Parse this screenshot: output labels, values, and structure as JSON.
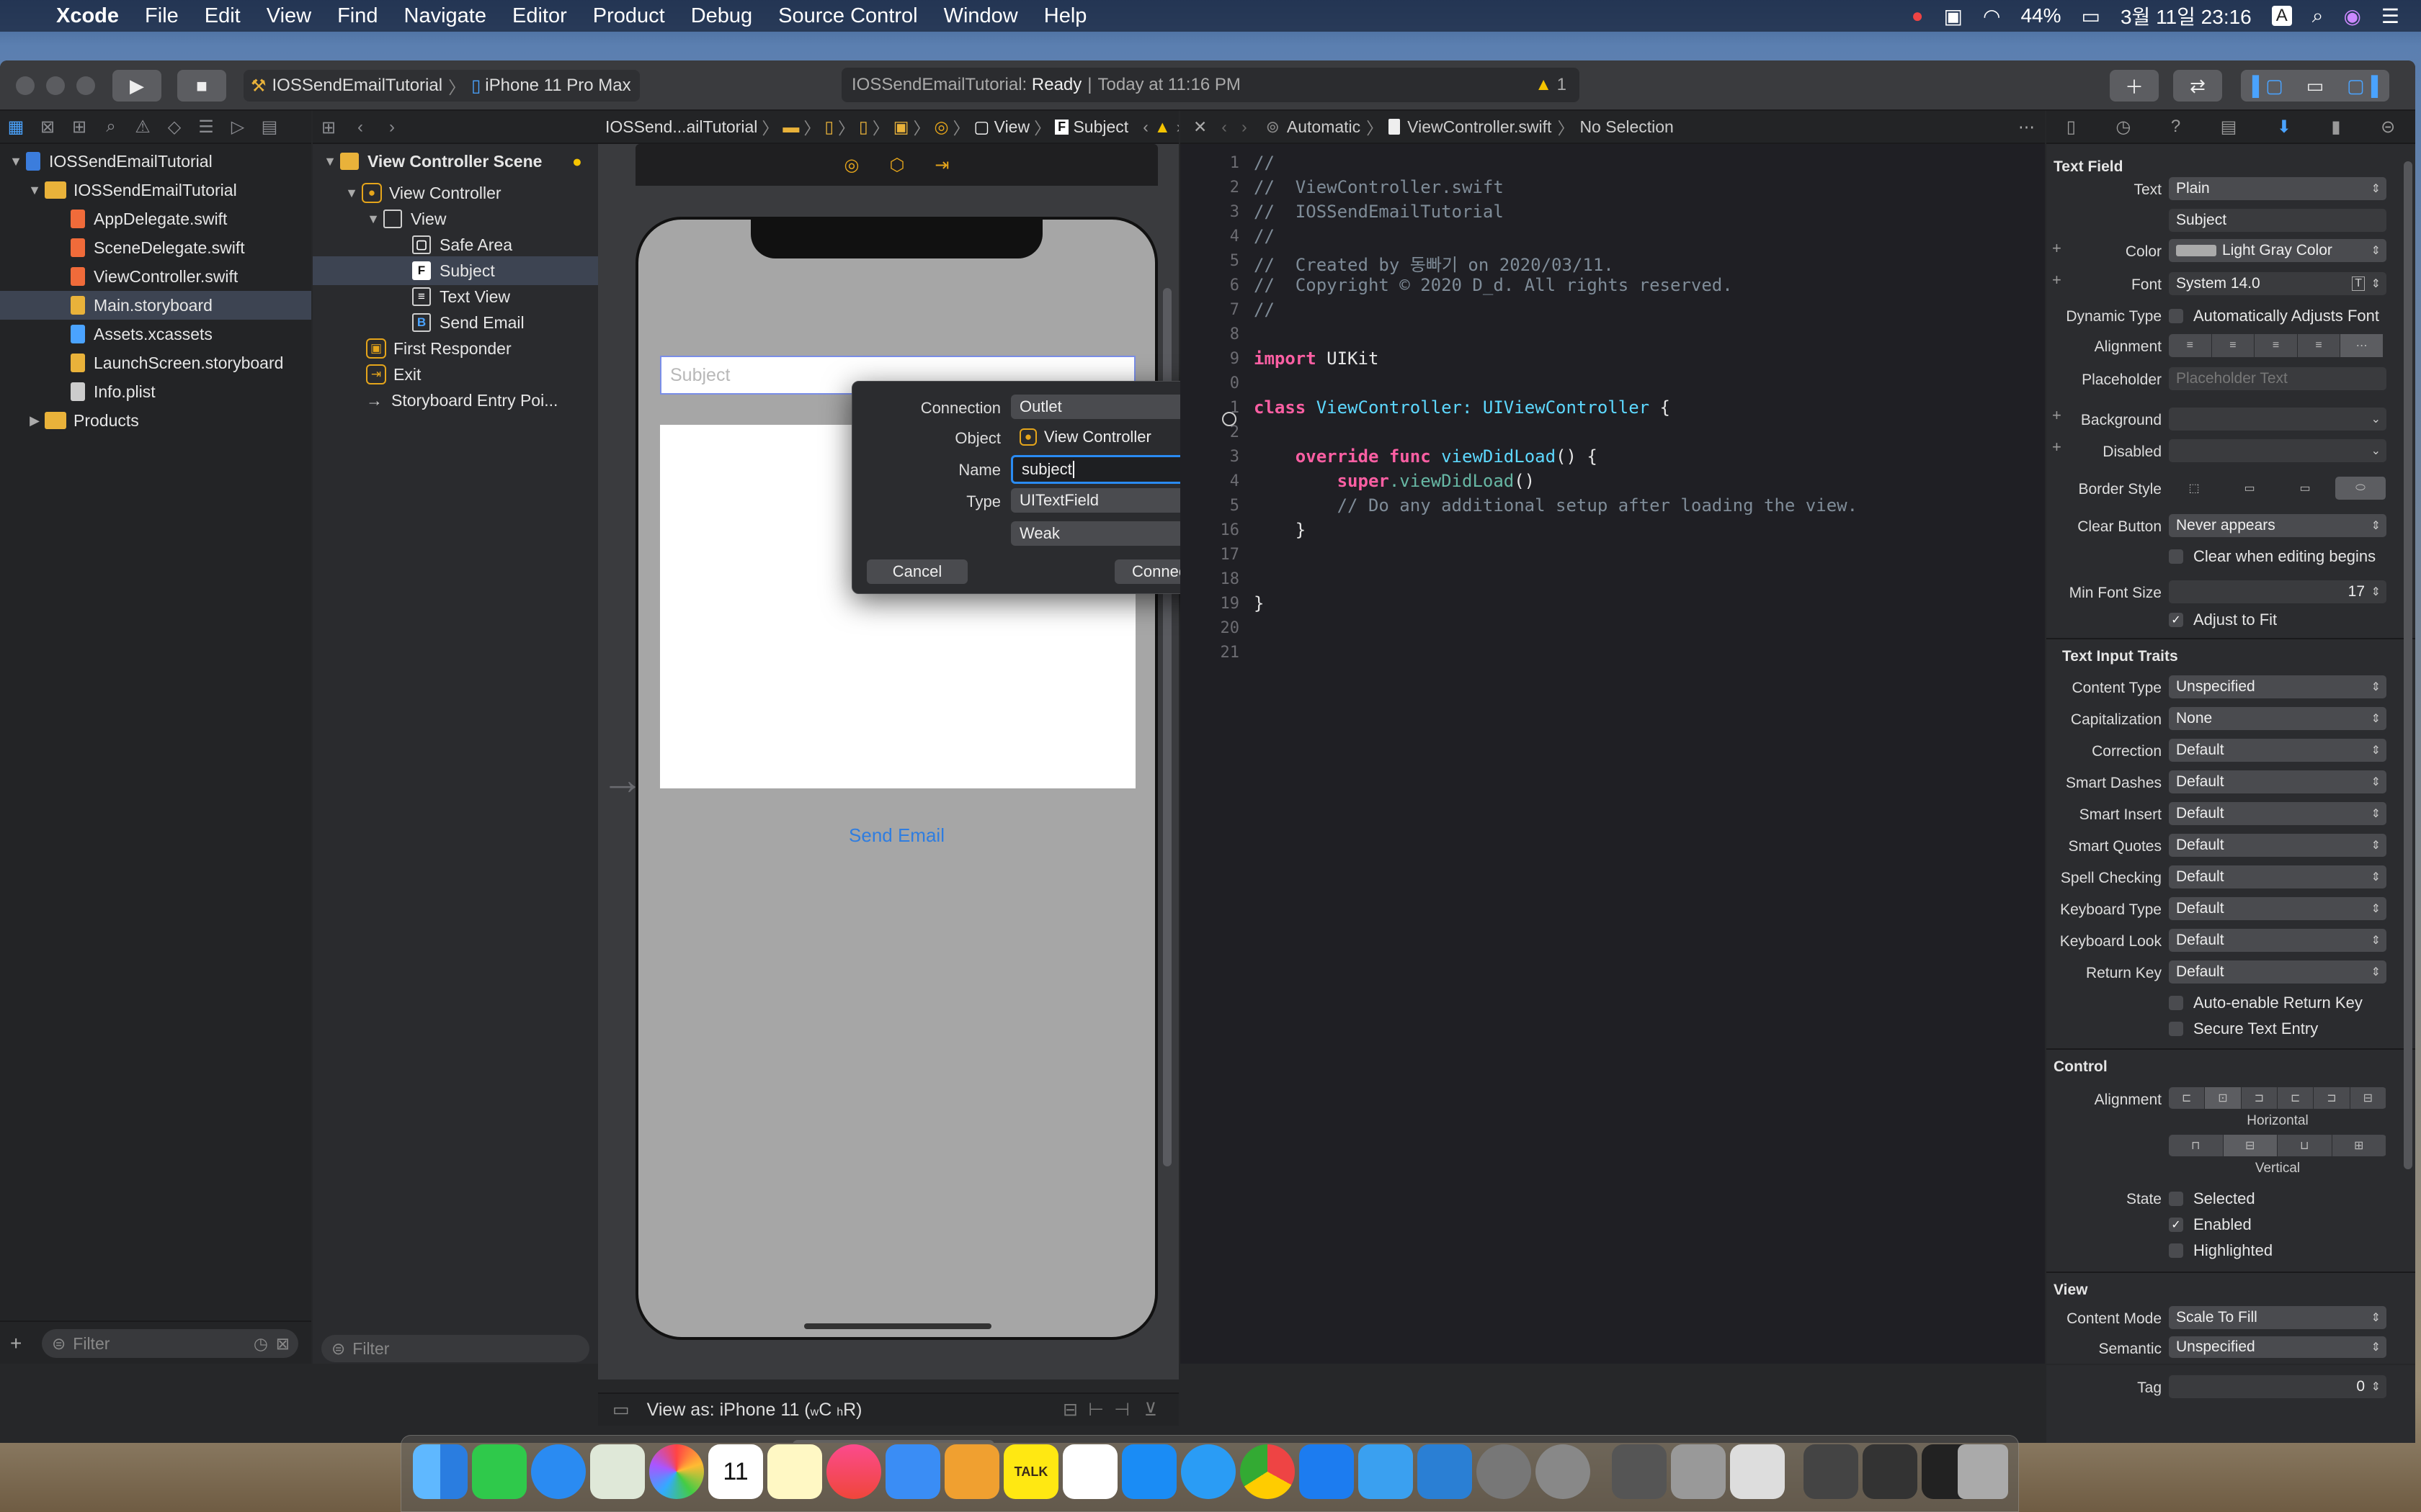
{
  "menubar": {
    "app": "Xcode",
    "items": [
      "File",
      "Edit",
      "View",
      "Find",
      "Navigate",
      "Editor",
      "Product",
      "Debug",
      "Source Control",
      "Window",
      "Help"
    ],
    "battery": "44%",
    "datetime": "3월 11일 23:16",
    "input_source": "A"
  },
  "toolbar": {
    "scheme": "IOSSendEmailTutorial",
    "device": "iPhone 11 Pro Max",
    "status_project": "IOSSendEmailTutorial:",
    "status_state": "Ready",
    "status_time": "Today at 11:16 PM",
    "warning_count": "1"
  },
  "navigator": {
    "items": [
      {
        "label": "IOSSendEmailTutorial",
        "kind": "project"
      },
      {
        "label": "IOSSendEmailTutorial",
        "kind": "folder"
      },
      {
        "label": "AppDelegate.swift",
        "kind": "swift"
      },
      {
        "label": "SceneDelegate.swift",
        "kind": "swift"
      },
      {
        "label": "ViewController.swift",
        "kind": "swift"
      },
      {
        "label": "Main.storyboard",
        "kind": "storyboard"
      },
      {
        "label": "Assets.xcassets",
        "kind": "assets"
      },
      {
        "label": "LaunchScreen.storyboard",
        "kind": "storyboard"
      },
      {
        "label": "Info.plist",
        "kind": "plist"
      },
      {
        "label": "Products",
        "kind": "folder"
      }
    ],
    "filter_placeholder": "Filter"
  },
  "jumpbar_left": {
    "project": "IOSSend...ailTutorial",
    "view": "View",
    "subject": "Subject"
  },
  "outline": {
    "items": [
      "View Controller Scene",
      "View Controller",
      "View",
      "Safe Area",
      "Subject",
      "Text View",
      "Send Email",
      "First Responder",
      "Exit",
      "Storyboard Entry Poi..."
    ],
    "filter_placeholder": "Filter"
  },
  "canvas": {
    "textfield_placeholder": "Subject",
    "button_label": "Send Email",
    "view_as": "View as: iPhone 11 (",
    "view_as_w": "w",
    "view_as_c": "C ",
    "view_as_h": "h",
    "view_as_r": "R)"
  },
  "popover": {
    "connection_label": "Connection",
    "connection_value": "Outlet",
    "object_label": "Object",
    "object_value": "View Controller",
    "name_label": "Name",
    "name_value": "subject",
    "type_label": "Type",
    "type_value": "UITextField",
    "storage_value": "Weak",
    "cancel": "Cancel",
    "connect": "Connect"
  },
  "editor": {
    "jumpbar": {
      "mode": "Automatic",
      "file": "ViewController.swift",
      "selection": "No Selection"
    },
    "line_numbers": [
      "1",
      "2",
      "3",
      "4",
      "5",
      "6",
      "7",
      "8",
      "9",
      "0",
      "1",
      "2",
      "3",
      "4",
      "5",
      "16",
      "17",
      "18",
      "19",
      "20",
      "21"
    ],
    "comments": [
      "//",
      "//  ViewController.swift",
      "//  IOSSendEmailTutorial",
      "//",
      "//  Created by 동빠기 on 2020/03/11.",
      "//  Copyright © 2020 D_d. All rights reserved.",
      "//"
    ],
    "import_kw": "import",
    "import_mod": "UIKit",
    "class_kw": "class",
    "class_name": "ViewController:",
    "class_super": "UIViewController",
    "brace_open": " {",
    "override_kw": "override func",
    "func_name": "viewDidLoad",
    "func_tail": "() {",
    "super_kw": "super",
    "super_call": ".viewDidLoad",
    "super_tail": "()",
    "comment_body": "// Do any additional setup after loading the view.",
    "inner_close": "}",
    "outer_close": "}"
  },
  "inspector": {
    "section_textfield": "Text Field",
    "text_label": "Text",
    "text_value": "Plain",
    "text_content": "Subject",
    "color_label": "Color",
    "color_value": "Light Gray Color",
    "font_label": "Font",
    "font_value": "System 14.0",
    "dynamic_label": "Dynamic Type",
    "dynamic_value": "Automatically Adjusts Font",
    "alignment_label": "Alignment",
    "placeholder_label": "Placeholder",
    "placeholder_value": "Placeholder Text",
    "background_label": "Background",
    "disabled_label": "Disabled",
    "border_label": "Border Style",
    "clear_label": "Clear Button",
    "clear_value": "Never appears",
    "clear_editing": "Clear when editing begins",
    "minfont_label": "Min Font Size",
    "minfont_value": "17",
    "adjust_fit": "Adjust to Fit",
    "section_traits": "Text Input Traits",
    "traits": [
      {
        "label": "Content Type",
        "value": "Unspecified"
      },
      {
        "label": "Capitalization",
        "value": "None"
      },
      {
        "label": "Correction",
        "value": "Default"
      },
      {
        "label": "Smart Dashes",
        "value": "Default"
      },
      {
        "label": "Smart Insert",
        "value": "Default"
      },
      {
        "label": "Smart Quotes",
        "value": "Default"
      },
      {
        "label": "Spell Checking",
        "value": "Default"
      },
      {
        "label": "Keyboard Type",
        "value": "Default"
      },
      {
        "label": "Keyboard Look",
        "value": "Default"
      },
      {
        "label": "Return Key",
        "value": "Default"
      }
    ],
    "auto_return": "Auto-enable Return Key",
    "secure": "Secure Text Entry",
    "section_control": "Control",
    "control_alignment_label": "Alignment",
    "horizontal": "Horizontal",
    "vertical": "Vertical",
    "state_label": "State",
    "state_selected": "Selected",
    "state_enabled": "Enabled",
    "state_highlighted": "Highlighted",
    "section_view": "View",
    "content_mode_label": "Content Mode",
    "content_mode_value": "Scale To Fill",
    "semantic_label": "Semantic",
    "semantic_value": "Unspecified",
    "tag_label": "Tag",
    "tag_value": "0"
  },
  "dock": {
    "calendar_day": "11",
    "kakao_label": "TALK"
  },
  "colors": {
    "accent": "#2f7de0",
    "keyword": "#fc5fa3",
    "type": "#5dd8ff",
    "comment": "#7f8c98",
    "selection": "#3d4452"
  }
}
